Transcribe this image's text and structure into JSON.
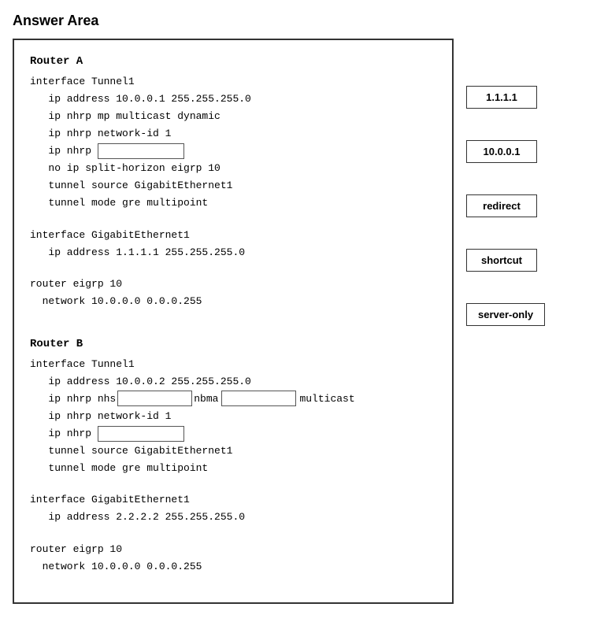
{
  "page": {
    "title": "Answer Area"
  },
  "answer_box": {
    "router_a": {
      "label": "Router A",
      "lines": [
        "interface Tunnel1",
        "   ip address 10.0.0.1 255.255.255.0",
        "   ip nhrp mp multicast dynamic",
        "   ip nhrp network-id 1",
        "   ip nhrp ",
        "   no ip split-horizon eigrp 10",
        "   tunnel source GigabitEthernet1",
        "   tunnel mode gre multipoint"
      ],
      "interface_ge": [
        "",
        "interface GigabitEthernet1",
        "   ip address 1.1.1.1 255.255.255.0"
      ],
      "router_eigrp": [
        "",
        "router eigrp 10",
        "  network 10.0.0.0 0.0.0.255"
      ]
    },
    "router_b": {
      "label": "Router B",
      "lines": [
        "interface Tunnel1",
        "   ip address 10.0.0.2 255.255.255.0",
        "   ip nhrp nhs",
        "   ip nhrp network-id 1",
        "   ip nhrp "
      ],
      "tunnel_lines": [
        "   tunnel source GigabitEthernet1",
        "   tunnel mode gre multipoint"
      ],
      "interface_ge": [
        "",
        "interface GigabitEthernet1",
        "   ip address 2.2.2.2 255.255.255.0"
      ],
      "router_eigrp": [
        "",
        "router eigrp 10",
        "  network 10.0.0.0 0.0.0.255"
      ]
    }
  },
  "options": {
    "opt1": "1.1.1.1",
    "opt2": "10.0.0.1",
    "opt3": "redirect",
    "opt4": "shortcut",
    "opt5": "server-only"
  }
}
